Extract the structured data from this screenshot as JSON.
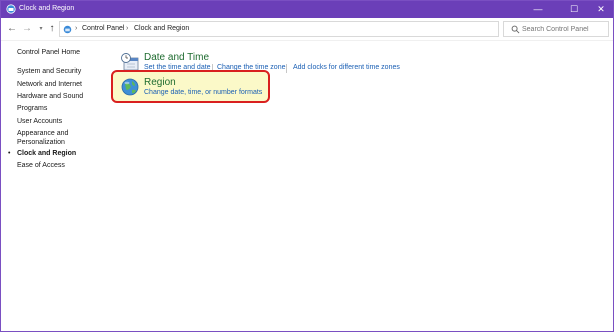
{
  "window": {
    "title": "Clock and Region"
  },
  "titlebar": {
    "minimize": "—",
    "maximize": "☐",
    "close": "✕"
  },
  "nav": {
    "back": "←",
    "forward": "→",
    "recent": "▾",
    "up": "↑"
  },
  "address": {
    "crumbs": [
      "Control Panel",
      "Clock and Region"
    ],
    "separator": "›",
    "dropdown": "▾",
    "refresh": "↻"
  },
  "search": {
    "placeholder": "Search Control Panel"
  },
  "sidebar": {
    "home": "Control Panel Home",
    "items": [
      "System and Security",
      "Network and Internet",
      "Hardware and Sound",
      "Programs",
      "User Accounts",
      "Appearance and",
      "Personalization",
      "Clock and Region",
      "Ease of Access"
    ],
    "bullet": "•"
  },
  "sections": [
    {
      "title": "Date and Time",
      "icon": "clock-calendar-icon",
      "tasks": [
        "Set the time and date",
        "Change the time zone",
        "Add clocks for different time zones"
      ]
    },
    {
      "title": "Region",
      "icon": "globe-icon",
      "tasks": [
        "Change date, time, or number formats"
      ]
    }
  ],
  "colors": {
    "titlebar": "#6b3fb8",
    "link": "#1a5fb4",
    "section_title": "#1e6b2f",
    "highlight_border": "#d9201f",
    "highlight_fill": "#fbf9c8"
  }
}
